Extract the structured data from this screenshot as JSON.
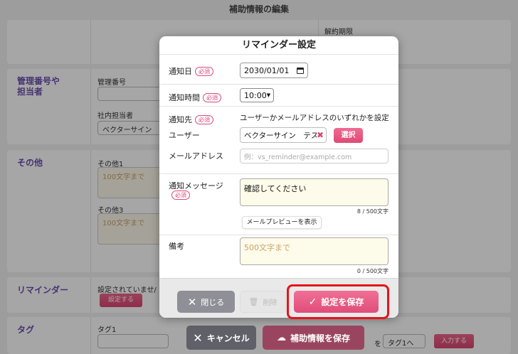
{
  "background": {
    "page_title": "補助情報の編集",
    "contract_end_label": "解約期限",
    "section_manager": "管理番号や\n担当者",
    "manager_number_label": "管理番号",
    "person_in_charge_label": "社内担当者",
    "person_in_charge_value": "ベクターサイン",
    "section_other": "その他",
    "other1_label": "その他1",
    "other1_placeholder": "100文字まで",
    "other3_label": "その他3",
    "other3_placeholder": "100文字まで",
    "section_reminder": "リマインダー",
    "reminder_status": "設定されていませ/",
    "reminder_set_button": "設定する",
    "section_tag": "タグ",
    "tag1_label": "タグ1",
    "tag_particle": "を",
    "tag_select": "タグ1へ",
    "tag_input_button": "入力する",
    "cancel_button": "キャンセル",
    "save_info_button": "補助情報を保存"
  },
  "modal": {
    "title": "リマインダー設定",
    "required_badge": "必須",
    "notify_date_label": "通知日",
    "notify_date_value": "2030/01/01",
    "notify_time_label": "通知時間",
    "notify_time_value": "10:00",
    "notify_to_label": "通知先",
    "notify_to_hint": "ユーザーかメールアドレスのいずれかを設定",
    "user_label": "ユーザー",
    "user_value": "ベクターサイン　テス",
    "select_button": "選択",
    "email_label": "メールアドレス",
    "email_placeholder": "例：vs_reminder@example.com",
    "message_label": "通知メッセージ",
    "message_value": "確認してください",
    "message_count": "8 / 500文字",
    "preview_button": "メールプレビューを表示",
    "remarks_label": "備考",
    "remarks_placeholder": "500文字まで",
    "remarks_count": "0 / 500文字",
    "close_button": "閉じる",
    "delete_button": "削除",
    "save_button": "設定を保存"
  },
  "colors": {
    "accent_pink": "#e04d78",
    "label_purple": "#6a4fb0",
    "highlight_red": "#e8121b"
  }
}
